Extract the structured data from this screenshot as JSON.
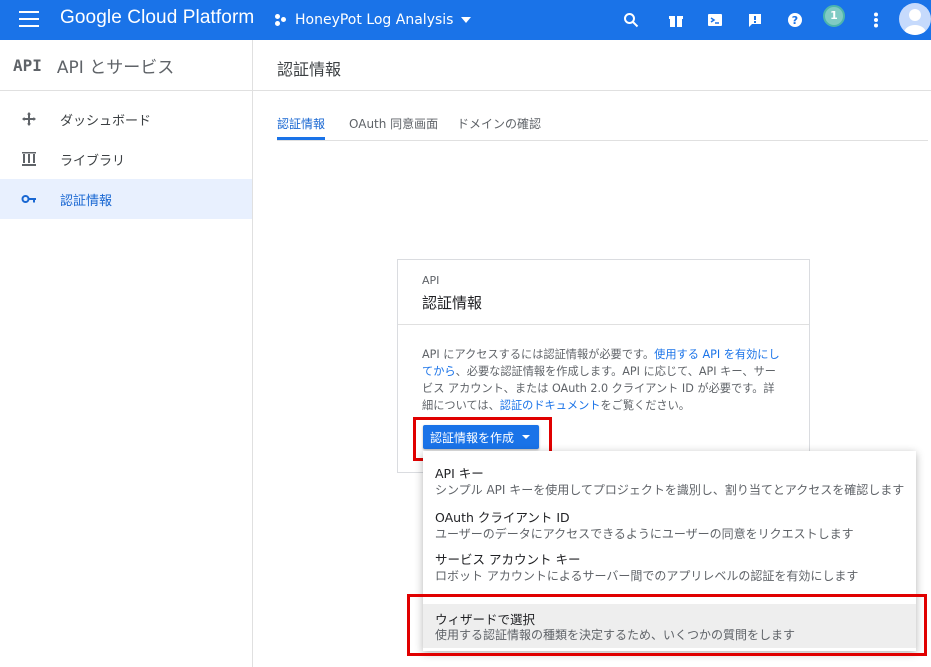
{
  "topbar": {
    "brand": "Google Cloud Platform",
    "project": "HoneyPot Log Analysis",
    "notification_count": "1",
    "bg_color": "#1a73e8"
  },
  "sidebar": {
    "logo": "API",
    "title": "API とサービス",
    "items": [
      {
        "label": "ダッシュボード",
        "icon": "dashboard-icon"
      },
      {
        "label": "ライブラリ",
        "icon": "library-icon"
      },
      {
        "label": "認証情報",
        "icon": "key-icon",
        "active": true
      }
    ]
  },
  "main": {
    "page_title": "認証情報",
    "tabs": [
      {
        "label": "認証情報",
        "active": true
      },
      {
        "label": "OAuth 同意画面"
      },
      {
        "label": "ドメインの確認"
      }
    ]
  },
  "card": {
    "subtitle": "API",
    "title": "認証情報",
    "body_1": "API にアクセスするには認証情報が必要です。",
    "link_1": "使用する API を有効にしてから",
    "body_2": "、必要な認証情報を作成します。API に応じて、API キー、サービス アカウント、または OAuth 2.0 クライアント ID が必要です。詳細については、",
    "link_2": "認証のドキュメント",
    "body_3": "をご覧ください。",
    "create_button": "認証情報を作成"
  },
  "menu": {
    "items": [
      {
        "title": "API キー",
        "desc": "シンプル API キーを使用してプロジェクトを識別し、割り当てとアクセスを確認します"
      },
      {
        "title": "OAuth クライアント ID",
        "desc": "ユーザーのデータにアクセスできるようにユーザーの同意をリクエストします"
      },
      {
        "title": "サービス アカウント キー",
        "desc": "ロボット アカウントによるサーバー間でのアプリレベルの認証を有効にします"
      },
      {
        "title": "ウィザードで選択",
        "desc": "使用する認証情報の種類を決定するため、いくつかの質問をします"
      }
    ]
  },
  "colors": {
    "highlight": "#e00000",
    "accent": "#1a73e8",
    "active_bg": "#e8f0fe"
  }
}
